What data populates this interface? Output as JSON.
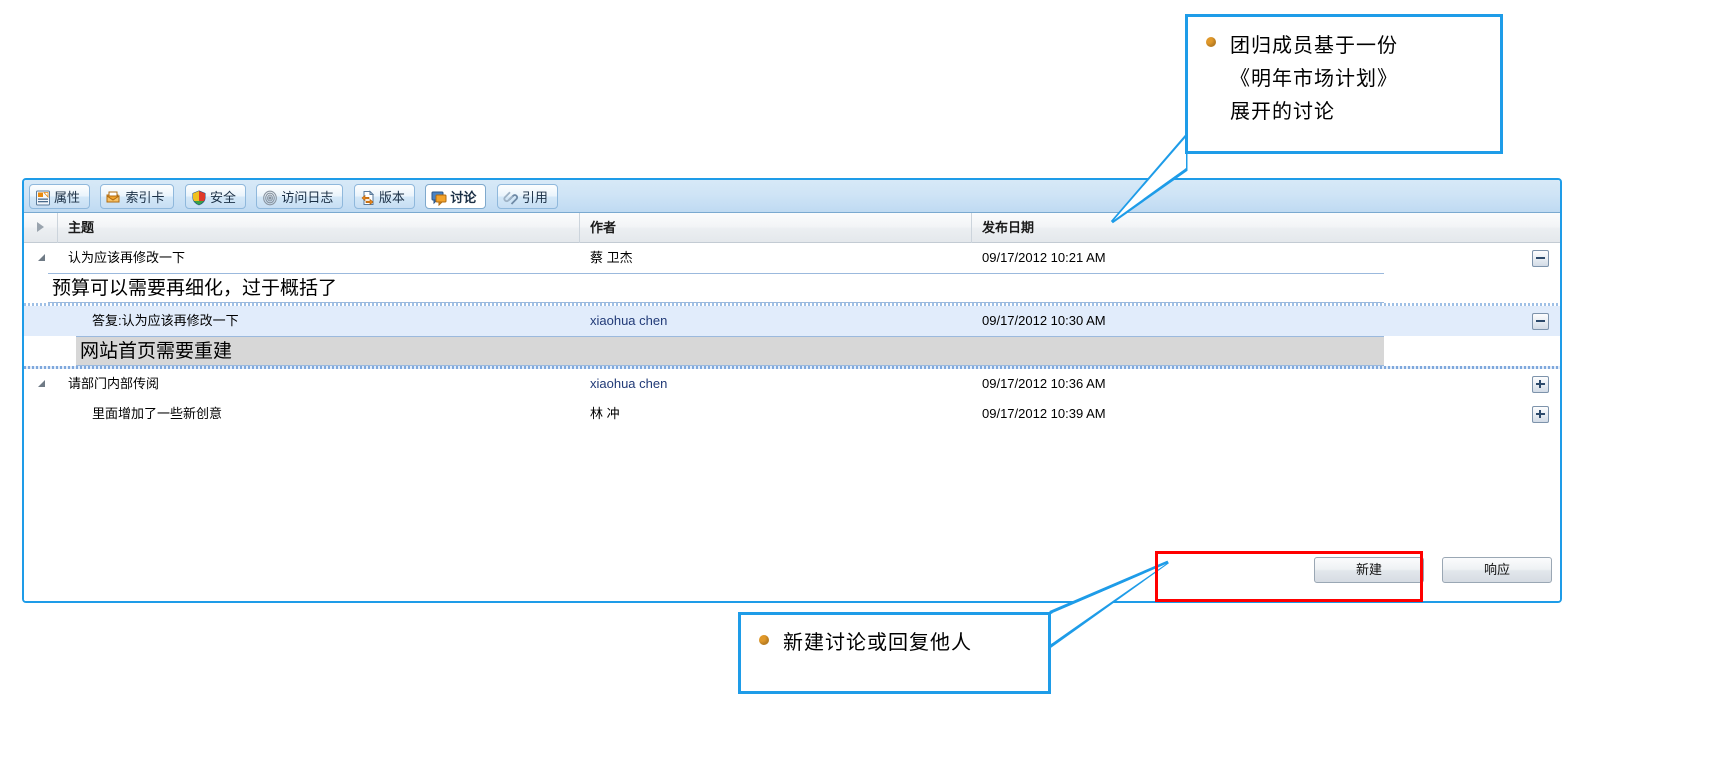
{
  "panel": {
    "tabs": [
      {
        "label": "属性",
        "icon": "properties-icon",
        "active": false
      },
      {
        "label": "索引卡",
        "icon": "index-card-icon",
        "active": false
      },
      {
        "label": "安全",
        "icon": "shield-security-icon",
        "active": false
      },
      {
        "label": "访问日志",
        "icon": "fingerprint-access-log-icon",
        "active": false
      },
      {
        "label": "版本",
        "icon": "version-icon",
        "active": false
      },
      {
        "label": "讨论",
        "icon": "discussion-icon",
        "active": true
      },
      {
        "label": "引用",
        "icon": "link-reference-icon",
        "active": false
      }
    ],
    "grid": {
      "columns": [
        {
          "key": "subject",
          "label": "主题"
        },
        {
          "key": "author",
          "label": "作者"
        },
        {
          "key": "date",
          "label": "发布日期"
        }
      ],
      "rows": [
        {
          "type": "topic",
          "level": 0,
          "subject": "认为应该再修改一下",
          "author": "蔡 卫杰",
          "author_style": "plain",
          "date": "09/17/2012 10:21 AM",
          "expander": "minus",
          "has_caret": true,
          "body": "预算可以需要再细化，过于概括了"
        },
        {
          "type": "reply",
          "level": 1,
          "subject": "答复:认为应该再修改一下",
          "author": "xiaohua chen",
          "author_style": "link",
          "date": "09/17/2012 10:30 AM",
          "expander": "minus",
          "has_caret": false,
          "body": "网站首页需要重建"
        },
        {
          "type": "topic",
          "level": 0,
          "subject": "请部门内部传阅",
          "author": "xiaohua chen",
          "author_style": "link",
          "date": "09/17/2012 10:36 AM",
          "expander": "plus",
          "has_caret": true,
          "body": null
        },
        {
          "type": "topic",
          "level": 0,
          "subject": "里面增加了一些新创意",
          "author": "林 冲",
          "author_style": "plain",
          "date": "09/17/2012 10:39 AM",
          "expander": "plus",
          "has_caret": false,
          "body": null
        }
      ]
    },
    "buttons": [
      {
        "label": "新建",
        "name": "new-discussion-button"
      },
      {
        "label": "响应",
        "name": "respond-button"
      }
    ]
  },
  "annotations": {
    "top": {
      "lines": [
        "团归成员基于一份",
        "《明年市场计划》",
        "展开的讨论"
      ],
      "bullet_color": "#e0982a"
    },
    "bottom": {
      "lines": [
        "新建讨论或回复他人"
      ],
      "bullet_color": "#e0982a"
    },
    "highlight_color": "#ff0000",
    "callout_border_color": "#1e9ce8"
  }
}
